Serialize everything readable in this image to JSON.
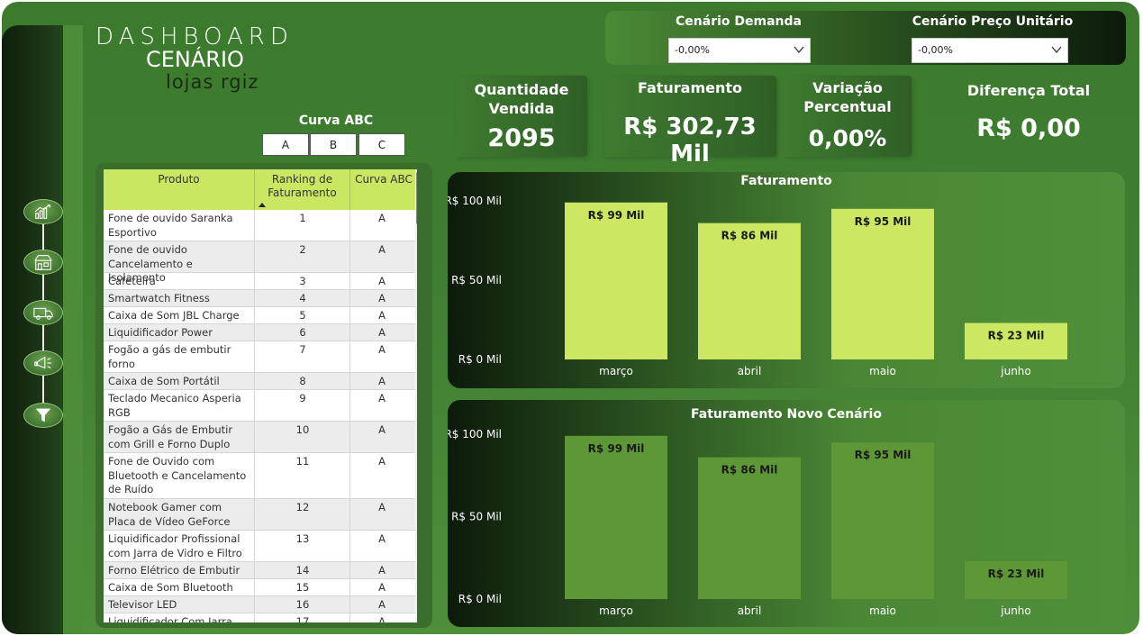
{
  "header": {
    "title_line1": "DASHBOARD",
    "title_line2": "CENÁRIO",
    "title_line3": "lojas rgiz"
  },
  "scenario": {
    "demand": {
      "label": "Cenário Demanda",
      "value": "-0,00%"
    },
    "price": {
      "label": "Cenário Preço Unitário",
      "value": "-0,00%"
    }
  },
  "kpis": {
    "quantity": {
      "label": "Quantidade Vendida",
      "value": "2095"
    },
    "revenue": {
      "label": "Faturamento",
      "value": "R$ 302,73 Mil"
    },
    "variation": {
      "label": "Variação Percentual",
      "value": "0,00%"
    },
    "difference": {
      "label": "Diferença Total",
      "value": "R$ 0,00"
    }
  },
  "nav": {
    "icons": [
      "chart-growth-icon",
      "store-icon",
      "truck-icon",
      "megaphone-icon",
      "filter-icon"
    ]
  },
  "abc_filter": {
    "title": "Curva ABC",
    "options": [
      "A",
      "B",
      "C"
    ]
  },
  "table": {
    "headers": [
      "Produto",
      "Ranking de Faturamento",
      "Curva ABC"
    ],
    "rows": [
      {
        "product": "Fone de ouvido Saranka Esportivo",
        "rank": "1",
        "abc": "A"
      },
      {
        "product": "Fone de ouvido Cancelamento e Isolamento",
        "rank": "2",
        "abc": "A"
      },
      {
        "product": "Cafeteira",
        "rank": "3",
        "abc": "A"
      },
      {
        "product": "Smartwatch Fitness",
        "rank": "4",
        "abc": "A"
      },
      {
        "product": "Caixa de Som JBL Charge",
        "rank": "5",
        "abc": "A"
      },
      {
        "product": "Liquidificador Power",
        "rank": "6",
        "abc": "A"
      },
      {
        "product": "Fogão a gás de embutir forno",
        "rank": "7",
        "abc": "A"
      },
      {
        "product": "Caixa de Som Portátil",
        "rank": "8",
        "abc": "A"
      },
      {
        "product": "Teclado Mecanico Asperia RGB",
        "rank": "9",
        "abc": "A"
      },
      {
        "product": "Fogão a Gás de Embutir com Grill e Forno Duplo",
        "rank": "10",
        "abc": "A"
      },
      {
        "product": "Fone de Ouvido com Bluetooth e Cancelamento de Ruído",
        "rank": "11",
        "abc": "A"
      },
      {
        "product": "Notebook Gamer com Placa de Vídeo GeForce",
        "rank": "12",
        "abc": "A"
      },
      {
        "product": "Liquidificador Profissional com Jarra de Vidro e Filtro",
        "rank": "13",
        "abc": "A"
      },
      {
        "product": "Forno Elétrico de Embutir",
        "rank": "14",
        "abc": "A"
      },
      {
        "product": "Caixa de Som Bluetooth",
        "rank": "15",
        "abc": "A"
      },
      {
        "product": "Televisor LED",
        "rank": "16",
        "abc": "A"
      },
      {
        "product": "Liquidificador Com Jarra",
        "rank": "17",
        "abc": "A"
      }
    ]
  },
  "colors": {
    "bar_primary": "#cce863",
    "bar_secondary": "#5e9836",
    "header_green": "#c9e761"
  },
  "chart_data": [
    {
      "type": "bar",
      "title": "Faturamento",
      "categories": [
        "março",
        "abril",
        "maio",
        "junho"
      ],
      "values": [
        99,
        86,
        95,
        23
      ],
      "data_labels": [
        "R$ 99 Mil",
        "R$ 86 Mil",
        "R$ 95 Mil",
        "R$ 23 Mil"
      ],
      "y_ticks": [
        "R$ 0 Mil",
        "R$ 50 Mil",
        "R$ 100 Mil"
      ],
      "ylim": [
        0,
        100
      ],
      "grid": false
    },
    {
      "type": "bar",
      "title": "Faturamento Novo Cenário",
      "categories": [
        "março",
        "abril",
        "maio",
        "junho"
      ],
      "values": [
        99,
        86,
        95,
        23
      ],
      "data_labels": [
        "R$ 99 Mil",
        "R$ 86 Mil",
        "R$ 95 Mil",
        "R$ 23 Mil"
      ],
      "y_ticks": [
        "R$ 0 Mil",
        "R$ 50 Mil",
        "R$ 100 Mil"
      ],
      "ylim": [
        0,
        100
      ],
      "grid": false
    }
  ]
}
